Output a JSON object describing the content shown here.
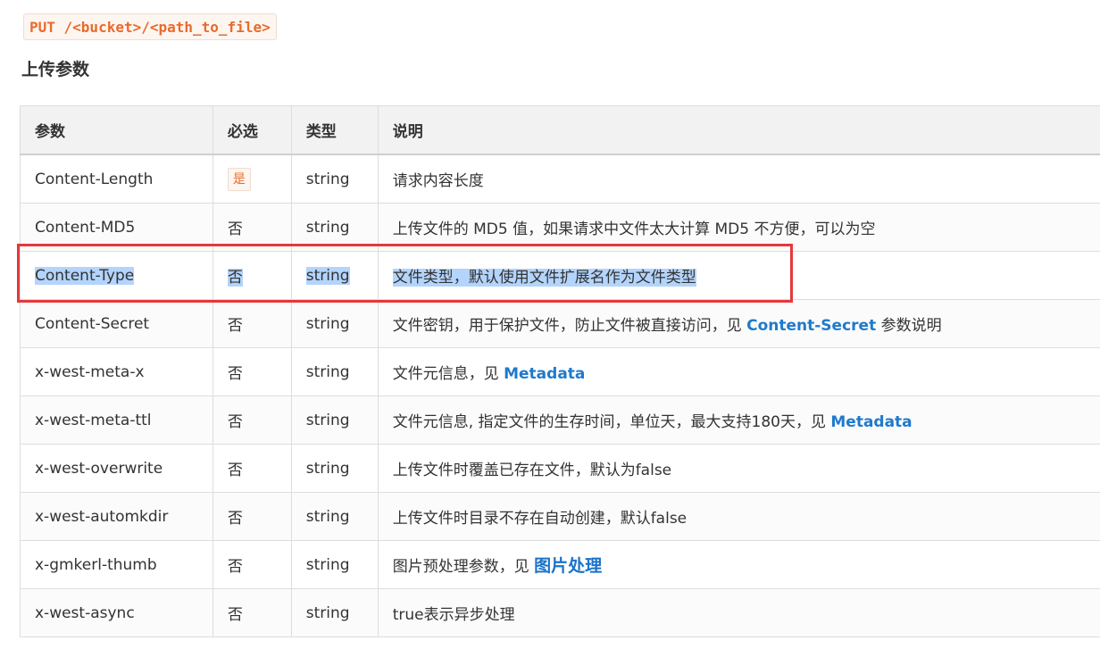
{
  "endpoint": "PUT /<bucket>/<path_to_file>",
  "section_title": "上传参数",
  "table": {
    "headers": {
      "param": "参数",
      "required": "必选",
      "type": "类型",
      "desc": "说明"
    },
    "rows": [
      {
        "param": "Content-Length",
        "required": "是",
        "type": "string",
        "desc": "请求内容长度"
      },
      {
        "param": "Content-MD5",
        "required": "否",
        "type": "string",
        "desc": "上传文件的 MD5 值，如果请求中文件太大计算 MD5 不方便，可以为空"
      },
      {
        "param": "Content-Type",
        "required": "否",
        "type": "string",
        "desc": "文件类型，默认使用文件扩展名作为文件类型"
      },
      {
        "param": "Content-Secret",
        "required": "否",
        "type": "string",
        "desc_before": "文件密钥，用于保护文件，防止文件被直接访问，见 ",
        "link": "Content-Secret",
        "desc_after": " 参数说明"
      },
      {
        "param": "x-west-meta-x",
        "required": "否",
        "type": "string",
        "desc_before": "文件元信息，见 ",
        "link": "Metadata"
      },
      {
        "param": "x-west-meta-ttl",
        "required": "否",
        "type": "string",
        "desc_before": "文件元信息, 指定文件的生存时间，单位天，最大支持180天，见 ",
        "link": "Metadata"
      },
      {
        "param": "x-west-overwrite",
        "required": "否",
        "type": "string",
        "desc": "上传文件时覆盖已存在文件，默认为false"
      },
      {
        "param": "x-west-automkdir",
        "required": "否",
        "type": "string",
        "desc": "上传文件时目录不存在自动创建，默认false"
      },
      {
        "param": "x-gmkerl-thumb",
        "required": "否",
        "type": "string",
        "desc_before": "图片预处理参数，见 ",
        "link": "图片处理"
      },
      {
        "param": "x-west-async",
        "required": "否",
        "type": "string",
        "desc": "true表示异步处理"
      }
    ]
  },
  "colors": {
    "accent_orange": "#e96b2d",
    "link_blue": "#1f7acb",
    "highlight_red": "#e5383b",
    "selection_blue": "#b3d4fc"
  }
}
